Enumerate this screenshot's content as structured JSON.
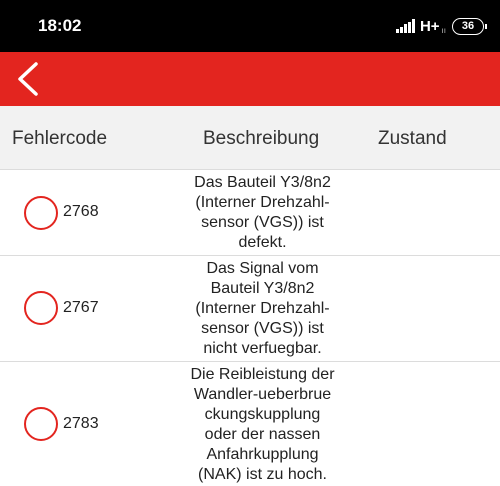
{
  "status_bar": {
    "time": "18:02",
    "network": "H+",
    "network_sub": "ıı",
    "battery": "36"
  },
  "app_bar": {
    "back_icon": "chevron-left-icon",
    "color": "#e3251f"
  },
  "table": {
    "headers": [
      "Fehlercode",
      "Beschreibung",
      "Zustand"
    ],
    "rows": [
      {
        "code": "2768",
        "description": [
          "Das Bauteil Y3/8n2",
          "(Interner Drehzahl-",
          "sensor (VGS)) ist",
          "defekt."
        ],
        "state": ""
      },
      {
        "code": "2767",
        "description": [
          "Das Signal vom",
          "Bauteil Y3/8n2",
          "(Interner Drehzahl-",
          "sensor (VGS)) ist",
          "nicht verfuegbar."
        ],
        "state": ""
      },
      {
        "code": "2783",
        "description": [
          "Die Reibleistung der",
          "Wandler-ueberbrue",
          "ckungskupplung",
          "oder der nassen",
          "Anfahrkupplung",
          "(NAK) ist zu hoch."
        ],
        "state": ""
      }
    ]
  }
}
